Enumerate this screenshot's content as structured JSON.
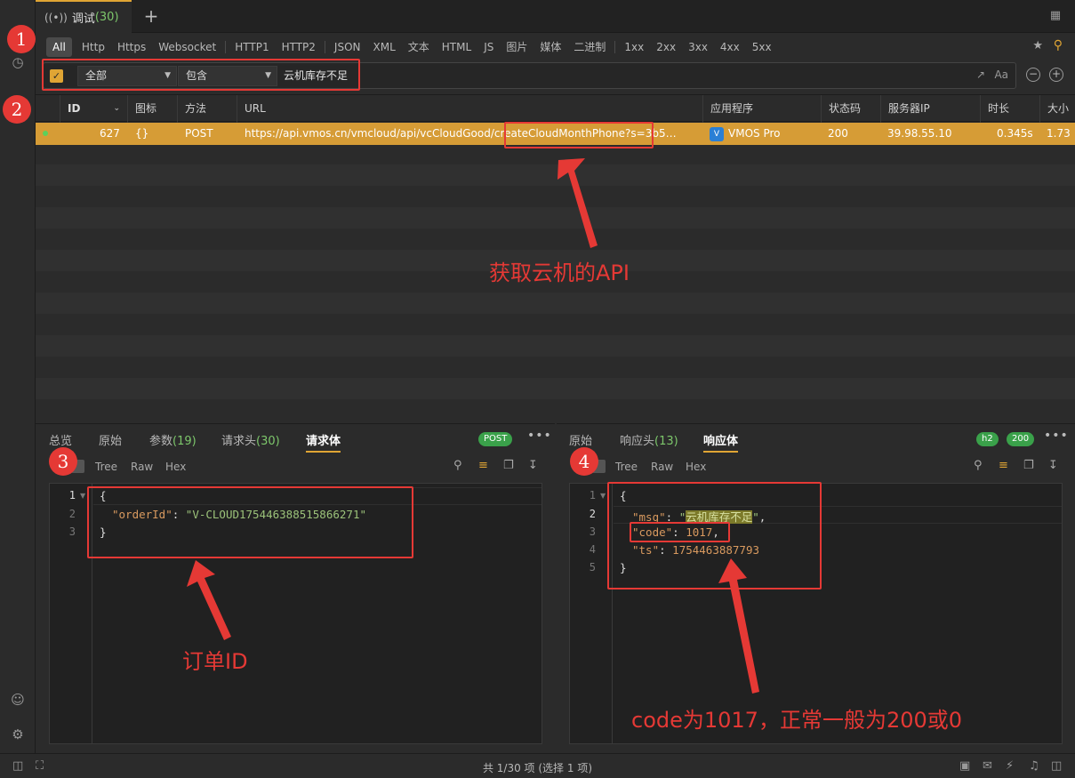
{
  "tabbar": {
    "tab_label": "调试",
    "tab_count": "(30)",
    "new_tab": "+"
  },
  "filters": [
    "All",
    "Http",
    "Https",
    "Websocket",
    "HTTP1",
    "HTTP2",
    "JSON",
    "XML",
    "文本",
    "HTML",
    "JS",
    "图片",
    "媒体",
    "二进制",
    "1xx",
    "2xx",
    "3xx",
    "4xx",
    "5xx"
  ],
  "search": {
    "scope": "全部",
    "mode": "包含",
    "value": "云机库存不足",
    "case_label": "Aa"
  },
  "table": {
    "columns": [
      "ID",
      "图标",
      "方法",
      "URL",
      "应用程序",
      "状态码",
      "服务器IP",
      "时长",
      "大小"
    ],
    "rows": [
      {
        "id": "627",
        "icon": "{}",
        "method": "POST",
        "url": "https://api.vmos.cn/vmcloud/api/vcCloudGood/createCloudMonthPhone?s=3b5…",
        "app": "VMOS Pro",
        "status": "200",
        "ip": "39.98.55.10",
        "duration": "0.345s",
        "size": "1.73"
      }
    ]
  },
  "left_pane": {
    "tabs": [
      "总览",
      "原始",
      "参数",
      "请求头",
      "请求体"
    ],
    "tab_counts": {
      "params": "(19)",
      "headers": "(30)"
    },
    "badge": "POST",
    "views": [
      "Tree",
      "Raw",
      "Hex"
    ],
    "lines": [
      "1",
      "2",
      "3"
    ],
    "code": {
      "open": "{",
      "key": "\"orderId\"",
      "colon": ": ",
      "value": "\"V-CLOUD175446388515866271\"",
      "close": "}"
    }
  },
  "right_pane": {
    "tabs": [
      "原始",
      "响应头",
      "响应体"
    ],
    "tab_counts": {
      "headers": "(13)"
    },
    "badges": [
      "h2",
      "200"
    ],
    "views": [
      "Tree",
      "Raw",
      "Hex"
    ],
    "lines": [
      "1",
      "2",
      "3",
      "4",
      "5"
    ],
    "code": {
      "open": "{",
      "msg_key": "\"msg\"",
      "msg_q1": "\"",
      "msg_val": "云机库存不足",
      "msg_q2": "\"",
      "code_key": "\"code\"",
      "code_val": "1017",
      "ts_key": "\"ts\"",
      "ts_val": "1754463887793",
      "close": "}"
    }
  },
  "status_bar": {
    "summary": "共 1/30 项 (选择 1 项)"
  },
  "annotations": {
    "markers": [
      "1",
      "2",
      "3",
      "4"
    ],
    "api_note": "获取云机的API",
    "order_note": "订单ID",
    "code_note": "code为1017，正常一般为200或0"
  },
  "colors": {
    "accent": "#e0a534",
    "selected_row": "#d69c36",
    "annotation": "#e53935",
    "success": "#3aa14a"
  }
}
